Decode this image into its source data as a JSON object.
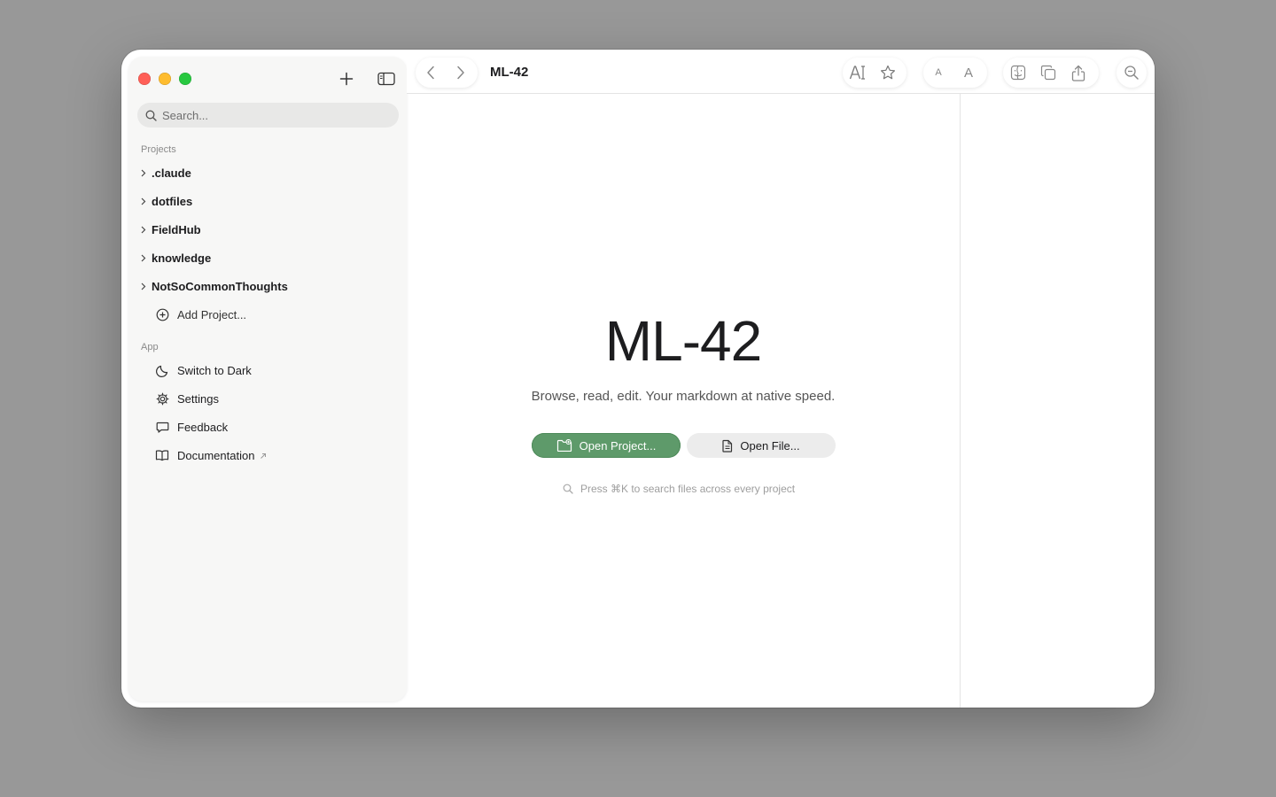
{
  "window": {
    "title": "ML-42"
  },
  "sidebar": {
    "search": {
      "placeholder": "Search..."
    },
    "projects_label": "Projects",
    "projects": [
      {
        "label": ".claude"
      },
      {
        "label": "dotfiles"
      },
      {
        "label": "FieldHub"
      },
      {
        "label": "knowledge"
      },
      {
        "label": "NotSoCommonThoughts"
      }
    ],
    "add_project_label": "Add Project...",
    "app_label": "App",
    "app_items": [
      {
        "label": "Switch to Dark",
        "icon": "moon-icon"
      },
      {
        "label": "Settings",
        "icon": "gear-icon"
      },
      {
        "label": "Feedback",
        "icon": "speech-bubble-icon"
      },
      {
        "label": "Documentation",
        "icon": "book-icon",
        "external": true
      }
    ]
  },
  "toolbar": {
    "doc_title": "ML-42",
    "icons": [
      "chevron-left-icon",
      "chevron-right-icon",
      "text-size-icon",
      "star-icon",
      "font-smaller-icon",
      "font-larger-icon",
      "finder-icon",
      "copy-icon",
      "share-icon",
      "zoom-icon"
    ]
  },
  "welcome": {
    "title": "ML-42",
    "subtitle": "Browse, read, edit. Your markdown at native speed.",
    "open_project_label": "Open Project...",
    "open_file_label": "Open File...",
    "hint": "Press ⌘K to search files across every project"
  },
  "colors": {
    "accent": "#5e9a6a",
    "background": "#989898",
    "sidebar": "#f7f7f6"
  }
}
